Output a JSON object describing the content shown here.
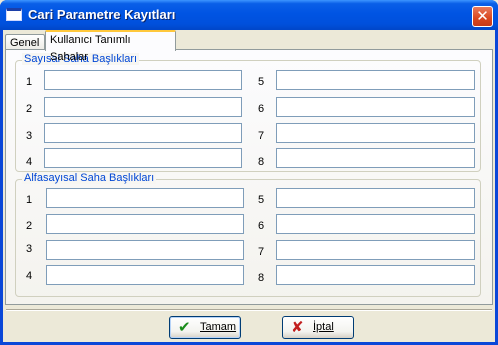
{
  "window": {
    "title": "Cari Parametre Kayıtları",
    "close_glyph": "✕"
  },
  "tabs": [
    {
      "label": "Genel",
      "active": false
    },
    {
      "label": "Kullanıcı Tanımlı Sahalar",
      "active": true
    }
  ],
  "numeric_group": {
    "title": "Sayısal Saha Başlıkları",
    "rows_left": [
      "1",
      "2",
      "3",
      "4"
    ],
    "rows_right": [
      "5",
      "6",
      "7",
      "8"
    ],
    "values": [
      "",
      "",
      "",
      "",
      "",
      "",
      "",
      ""
    ]
  },
  "alpha_group": {
    "title": "Alfasayısal Saha Başlıkları",
    "rows_left": [
      "1",
      "2",
      "3",
      "4"
    ],
    "rows_right": [
      "5",
      "6",
      "7",
      "8"
    ],
    "values": [
      "",
      "",
      "",
      "",
      "",
      "",
      "",
      ""
    ]
  },
  "buttons": {
    "ok_label": "Tamam",
    "ok_icon": "check-icon",
    "cancel_label": "İptal",
    "cancel_icon": "cross-icon"
  },
  "colors": {
    "titlebar": "#0054e3",
    "group_title": "#0046d5",
    "close_button": "#d9471f"
  }
}
